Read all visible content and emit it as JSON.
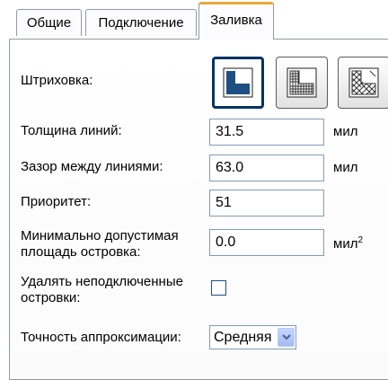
{
  "tabs": [
    {
      "label": "Общие",
      "active": false
    },
    {
      "label": "Подключение",
      "active": false
    },
    {
      "label": "Заливка",
      "active": true
    }
  ],
  "hatching": {
    "label": "Штриховка:",
    "options": [
      {
        "icon": "solid-fill-icon",
        "selected": true
      },
      {
        "icon": "orthogonal-hatch-icon",
        "selected": false
      },
      {
        "icon": "diagonal-hatch-icon",
        "selected": false
      }
    ]
  },
  "line_width": {
    "label": "Толщина линий:",
    "value": "31.5",
    "unit": "мил"
  },
  "line_gap": {
    "label": "Зазор между линиями:",
    "value": "63.0",
    "unit": "мил"
  },
  "priority": {
    "label": "Приоритет:",
    "value": "51"
  },
  "min_island_area": {
    "label_line1": "Минимально допустимая",
    "label_line2": "площадь островка:",
    "value": "0.0",
    "unit": "мил",
    "unit_sup": "2"
  },
  "remove_islands": {
    "label_line1": "Удалять неподключенные",
    "label_line2": "островки:",
    "checked": false
  },
  "approx_accuracy": {
    "label": "Точность аппроксимации:",
    "value": "Средняя"
  },
  "colors": {
    "active_tab_accent": "#e8a83a",
    "selected_border": "#003366",
    "solid_fill": "#1f4f82"
  }
}
